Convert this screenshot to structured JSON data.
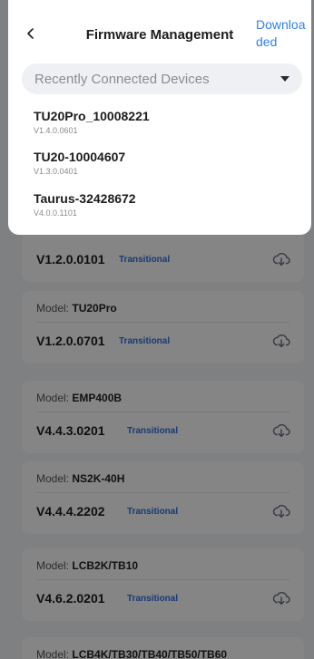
{
  "header": {
    "title": "Firmware Management",
    "downloaded_label": "Downloaded",
    "downloaded_line1": "Downloa",
    "downloaded_line2": "ded"
  },
  "dropdown": {
    "selected": "Recently Connected Devices",
    "devices": [
      {
        "name": "TU20Pro_10008221",
        "version": "V1.4.0.0601"
      },
      {
        "name": "TU20-10004607",
        "version": "V1.3.0.0401"
      },
      {
        "name": "Taurus-32428672",
        "version": "V4.0.0.1101"
      }
    ]
  },
  "firmware_list": {
    "model_prefix": "Model: ",
    "items": [
      {
        "model": "",
        "version": "V1.2.0.0101",
        "tag": "Transitional"
      },
      {
        "model": "TU20Pro",
        "version": "V1.2.0.0701",
        "tag": "Transitional"
      },
      {
        "model": "EMP400B",
        "version": "V4.4.3.0201",
        "tag": "Transitional"
      },
      {
        "model": "NS2K-40H",
        "version": "V4.4.4.2202",
        "tag": "Transitional"
      },
      {
        "model": "LCB2K/TB10",
        "version": "V4.6.2.0201",
        "tag": "Transitional"
      },
      {
        "model": "LCB4K/TB30/TB40/TB50/TB60",
        "version": "",
        "tag": ""
      }
    ]
  },
  "colors": {
    "accent": "#2f80ed",
    "tag": "#2f6fe0",
    "overlay": "rgba(0,0,0,0.48)"
  }
}
